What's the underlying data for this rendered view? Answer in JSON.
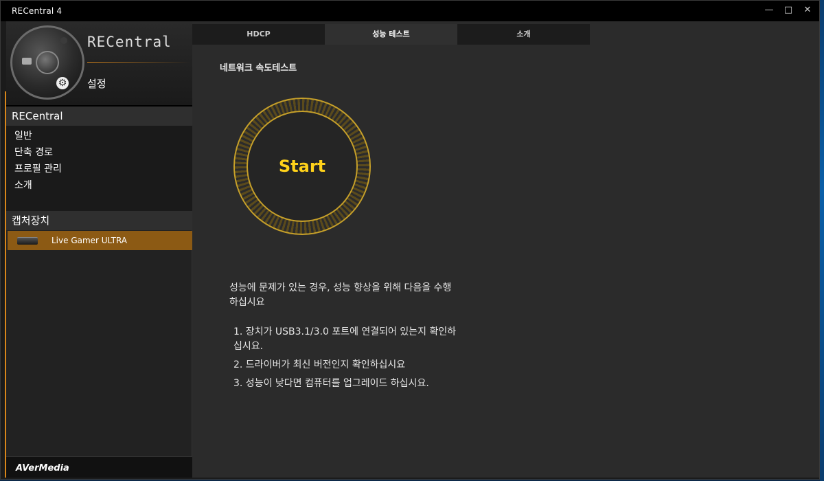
{
  "window": {
    "title": "RECentral 4",
    "min_glyph": "—",
    "max_glyph": "□",
    "close_glyph": "✕"
  },
  "logo": {
    "brand": "RECentral",
    "section": "설정"
  },
  "sidebar": {
    "recentral_header": "RECentral",
    "items": [
      {
        "label": "일반"
      },
      {
        "label": "단축 경로"
      },
      {
        "label": "프로필 관리"
      },
      {
        "label": "소개"
      }
    ],
    "capture_header": "캡처장치",
    "device": {
      "label": "Live Gamer ULTRA"
    },
    "footer_brand": "AVerMedia"
  },
  "tabs": [
    {
      "label": "HDCP"
    },
    {
      "label": "성능 테스트"
    },
    {
      "label": "소개"
    }
  ],
  "main": {
    "section_title": "네트워크 속도테스트",
    "start_label": "Start",
    "info": "성능에 문제가 있는 경우, 성능 향상을 위해 다음을 수행하십시요",
    "steps": [
      "1. 장치가 USB3.1/3.0 포트에 연결되어 있는지 확인하십시요.",
      "2. 드라이버가 최신 버전인지 확인하십시요",
      "3. 성능이 낮다면 컴퓨터를 업그레이드 하십시요."
    ]
  },
  "colors": {
    "accent_orange": "#d9861a",
    "start_gold": "#ffd21a",
    "ring_gold": "#c6a02a"
  }
}
